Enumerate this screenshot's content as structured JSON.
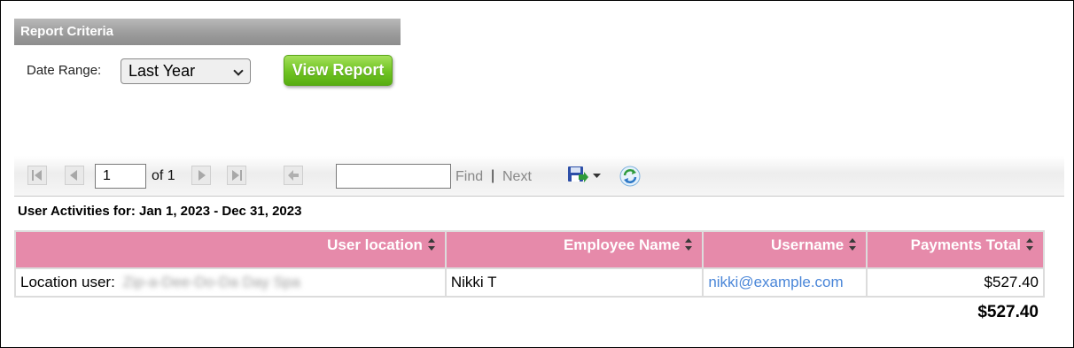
{
  "criteria": {
    "header": "Report Criteria",
    "date_range_label": "Date Range:",
    "date_range_value": "Last Year",
    "view_report_label": "View Report"
  },
  "toolbar": {
    "page_number": "1",
    "page_of": "of 1",
    "find_label": "Find",
    "separator": "|",
    "next_label": "Next",
    "find_value": ""
  },
  "report": {
    "heading": "User Activities for: Jan 1, 2023 - Dec 31, 2023",
    "columns": [
      "User location",
      "Employee Name",
      "Username",
      "Payments Total"
    ],
    "rows": [
      {
        "location_prefix": "Location user:",
        "location_name": "Zip-a-Dee-Do-Da Day Spa",
        "employee": "Nikki T",
        "username": "nikki@example.com",
        "payments_total": "$527.40"
      }
    ],
    "grand_total": "$527.40"
  },
  "colors": {
    "header_pink": "#e68aaa",
    "button_green": "#6fc321",
    "link_blue": "#4a86d8"
  },
  "icons": [
    "first-page-icon",
    "previous-page-icon",
    "next-page-icon",
    "last-page-icon",
    "back-icon",
    "save-icon",
    "refresh-icon"
  ]
}
